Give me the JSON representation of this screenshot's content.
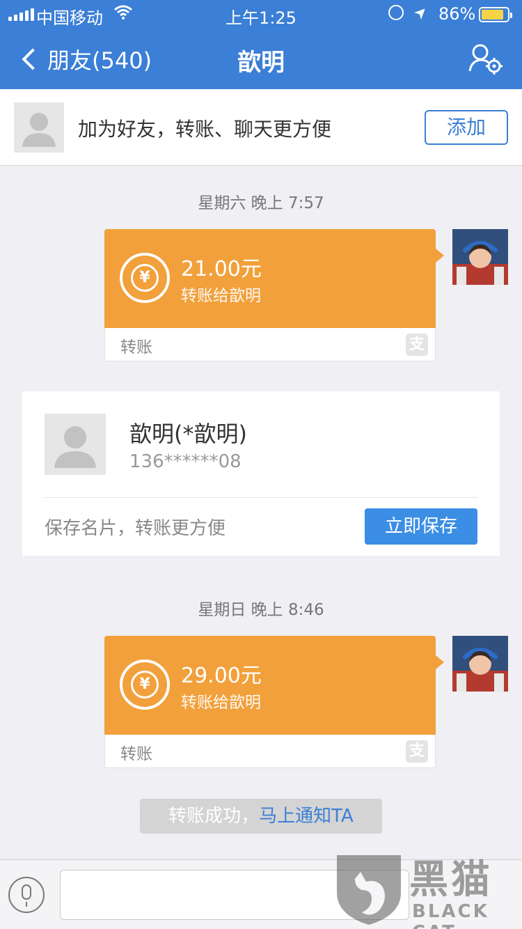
{
  "status_bar": {
    "carrier": "中国移动",
    "time": "上午1:25",
    "battery_pct": "86%",
    "battery_level": 0.86,
    "icons": [
      "signal-icon",
      "wifi-icon",
      "orientation-lock-icon",
      "location-icon",
      "battery-icon"
    ]
  },
  "nav": {
    "back_label": "朋友(540)",
    "title": "歆明",
    "right_icon": "profile-settings-icon"
  },
  "add_friend": {
    "message": "加为好友，转账、聊天更方便",
    "button": "添加"
  },
  "messages": [
    {
      "timestamp": "星期六 晚上 7:57",
      "amount": "21.00元",
      "subtitle": "转账给歆明",
      "label": "转账"
    },
    {
      "timestamp": "星期日 晚上 8:46",
      "amount": "29.00元",
      "subtitle": "转账给歆明",
      "label": "转账"
    }
  ],
  "contact_card": {
    "name": "歆明(*歆明)",
    "phone": "136******08",
    "hint": "保存名片，转账更方便",
    "button": "立即保存"
  },
  "notice": {
    "text": "转账成功，",
    "link": "马上通知TA"
  },
  "colors": {
    "header": "#3b7fd6",
    "transfer_card": "#f2a03b",
    "save_button": "#3b8ee4"
  },
  "watermark": {
    "cn": "黑猫",
    "en": "BLACK CAT"
  }
}
